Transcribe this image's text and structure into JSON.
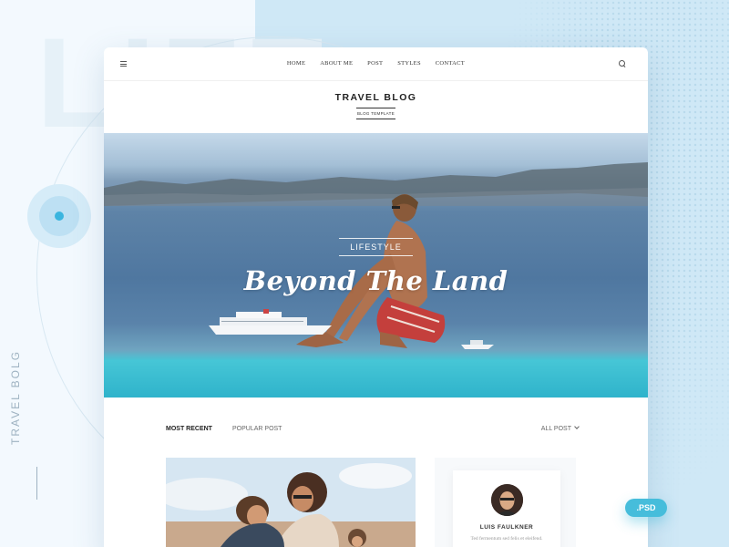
{
  "background": {
    "side_label": "TRAVEL BOLG",
    "accent_color": "#3bb5df"
  },
  "nav": {
    "items": [
      "HOME",
      "ABOUT ME",
      "POST",
      "STYLES",
      "CONTACT"
    ]
  },
  "brand": {
    "title": "TRAVEL BLOG",
    "subtitle": "BLOG TEMPLATE"
  },
  "hero": {
    "category": "LIFESTYLE",
    "title": "Beyond The Land"
  },
  "tabs": {
    "most_recent": "MOST RECENT",
    "popular": "POPULAR POST",
    "all_post": "ALL POST"
  },
  "author": {
    "name": "LUIS FAULKNER",
    "bio": "Ted fermentum sed felis et eleifend."
  },
  "badge": {
    "label": ".PSD"
  }
}
